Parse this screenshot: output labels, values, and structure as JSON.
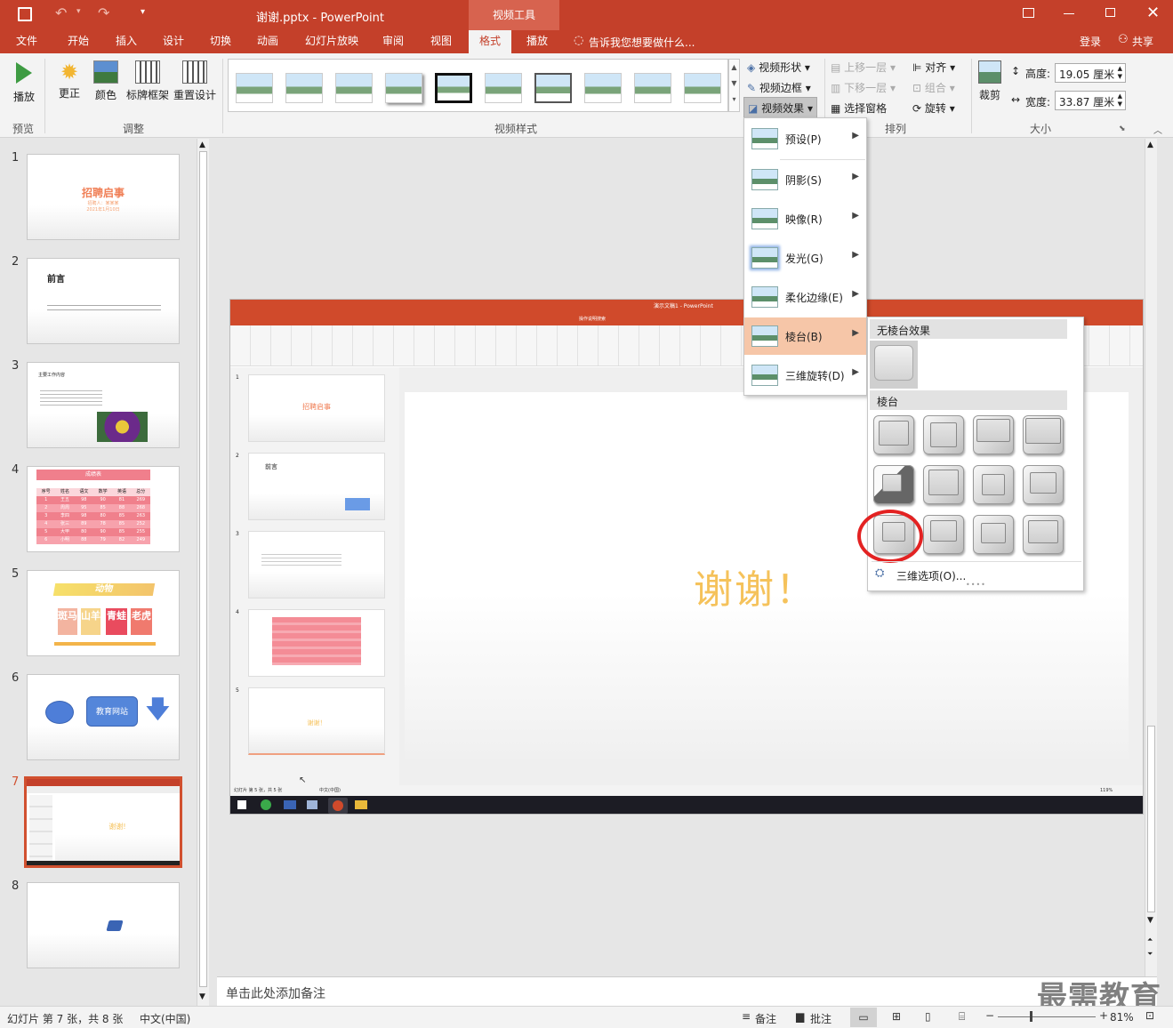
{
  "window": {
    "title": "谢谢.pptx - PowerPoint",
    "context_tool": "视频工具",
    "tell_me": "告诉我您想要做什么...",
    "login": "登录",
    "share": "共享"
  },
  "tabs": [
    "文件",
    "开始",
    "插入",
    "设计",
    "切换",
    "动画",
    "幻灯片放映",
    "审阅",
    "视图",
    "格式",
    "播放"
  ],
  "active_tab": "格式",
  "ribbon": {
    "preview": {
      "play": "播放",
      "group": "预览"
    },
    "adjust": {
      "correct": "更正",
      "color": "颜色",
      "poster": "标牌框架",
      "reset": "重置设计",
      "group": "调整"
    },
    "styles_group": "视频样式",
    "video_shape": "视频形状",
    "video_border": "视频边框",
    "video_effects": "视频效果",
    "arrange": {
      "up": "上移一层",
      "down": "下移一层",
      "selpane": "选择窗格",
      "align": "对齐",
      "group_cmd": "组合",
      "rotate": "旋转",
      "group": "排列"
    },
    "size": {
      "crop": "裁剪",
      "height_label": "高度:",
      "height": "19.05 厘米",
      "width_label": "宽度:",
      "width": "33.87 厘米",
      "group": "大小"
    }
  },
  "effects_menu": [
    {
      "label": "预设(P)"
    },
    {
      "label": "阴影(S)"
    },
    {
      "label": "映像(R)"
    },
    {
      "label": "发光(G)"
    },
    {
      "label": "柔化边缘(E)"
    },
    {
      "label": "棱台(B)"
    },
    {
      "label": "三维旋转(D)"
    }
  ],
  "bevel_menu": {
    "no_bevel": "无棱台效果",
    "bevel": "棱台",
    "options": "三维选项(O)..."
  },
  "slides": [
    {
      "num": "1",
      "title": "招聘启事",
      "sub1": "招聘人：某某某",
      "sub2": "2021年1月10日"
    },
    {
      "num": "2",
      "title": "前言"
    },
    {
      "num": "3",
      "title": "主要工作内容"
    },
    {
      "num": "4",
      "title": "成绩表",
      "headers": [
        "序号",
        "姓名",
        "语文",
        "数学",
        "英语",
        "总分"
      ],
      "rows": [
        [
          "1",
          "王五",
          "98",
          "90",
          "81",
          "269"
        ],
        [
          "2",
          "周周",
          "95",
          "85",
          "88",
          "268"
        ],
        [
          "3",
          "李四",
          "98",
          "80",
          "85",
          "263"
        ],
        [
          "4",
          "张三",
          "89",
          "78",
          "85",
          "252"
        ],
        [
          "5",
          "大甲",
          "80",
          "90",
          "85",
          "255"
        ],
        [
          "6",
          "小明",
          "88",
          "79",
          "82",
          "249"
        ]
      ]
    },
    {
      "num": "5",
      "title": "动物",
      "cells": [
        "斑马",
        "山羊",
        "青蛙",
        "老虎"
      ]
    },
    {
      "num": "6",
      "label": "教育网站"
    },
    {
      "num": "7",
      "label": "谢谢!"
    },
    {
      "num": "8"
    }
  ],
  "main_slide": {
    "text": "谢谢！",
    "inner_title": "演示文稿1 - PowerPoint",
    "inner_tell": "操作说明搜索",
    "inner_status": "幻灯片 第 5 张，共 5 张",
    "inner_lang": "中文(中国)",
    "inner_zoom": "119%",
    "inner_slides": [
      {
        "num": "1",
        "title": "招聘启事"
      },
      {
        "num": "2",
        "title": "前言"
      },
      {
        "num": "3"
      },
      {
        "num": "4"
      },
      {
        "num": "5",
        "title": "谢谢！"
      }
    ]
  },
  "notes": "单击此处添加备注",
  "status": {
    "slide_info": "幻灯片 第 7 张，共 8 张",
    "language": "中文(中国)",
    "notes_btn": "备注",
    "comments_btn": "批注",
    "zoom": "81%"
  },
  "watermark": "最需教育",
  "colors": {
    "accent": "#c4402a",
    "highlight": "#f6c6a8",
    "circle": "#e32222",
    "thanks": "#f5c25b"
  }
}
